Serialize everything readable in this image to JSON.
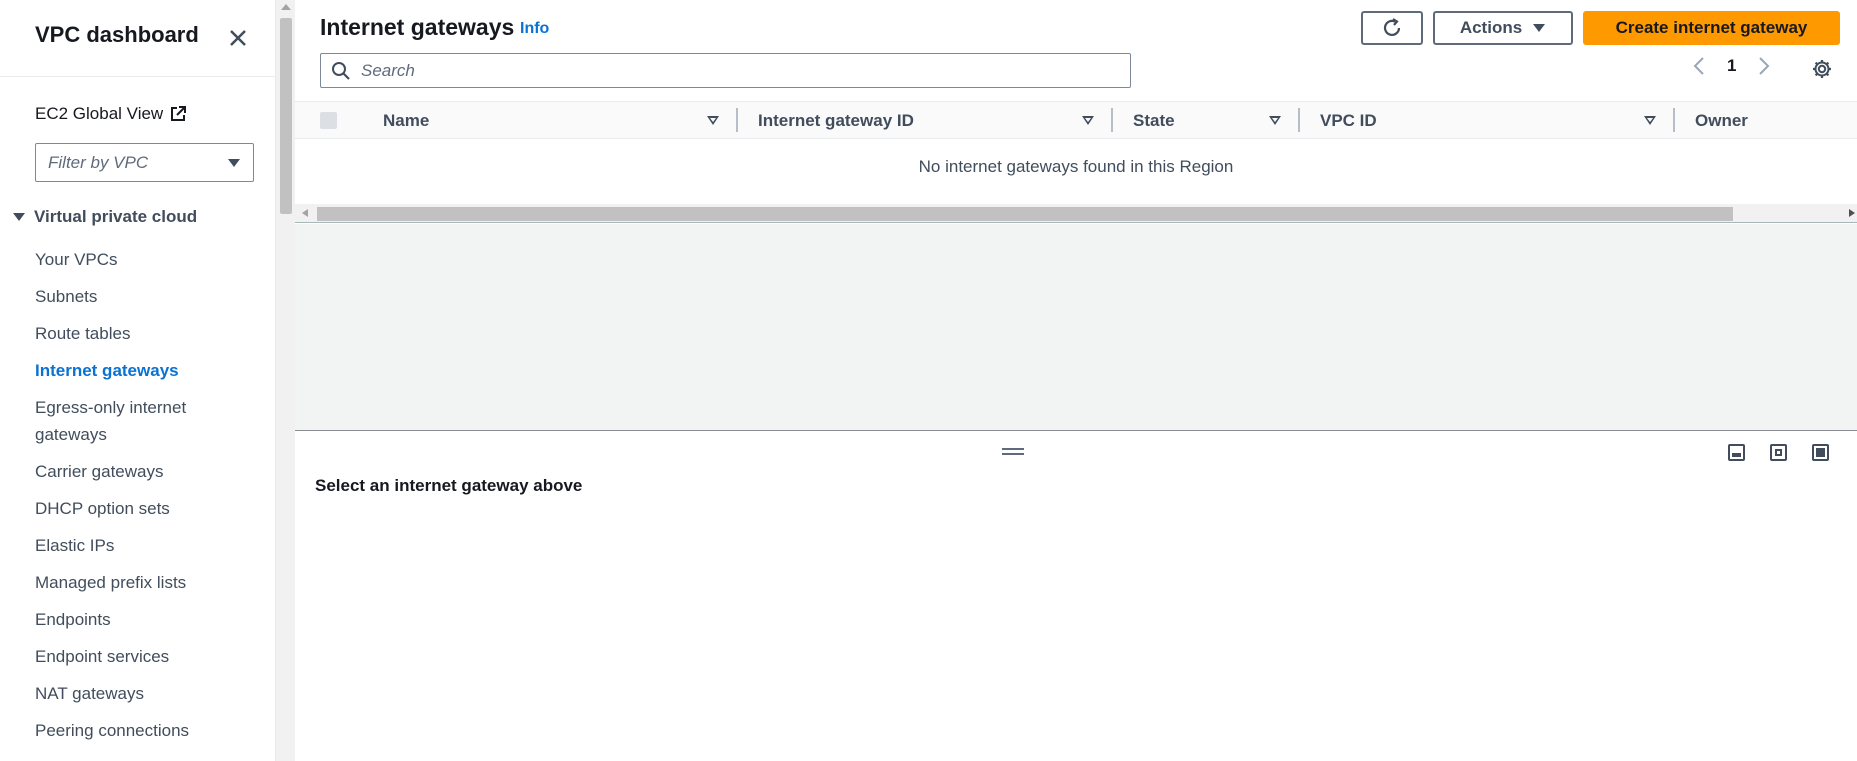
{
  "sidebar": {
    "title": "VPC dashboard",
    "global_view": "EC2 Global View",
    "filter_placeholder": "Filter by VPC",
    "section": "Virtual private cloud",
    "items": [
      {
        "label": "Your VPCs"
      },
      {
        "label": "Subnets"
      },
      {
        "label": "Route tables"
      },
      {
        "label": "Internet gateways",
        "active": true
      },
      {
        "label": "Egress-only internet gateways"
      },
      {
        "label": "Carrier gateways"
      },
      {
        "label": "DHCP option sets"
      },
      {
        "label": "Elastic IPs"
      },
      {
        "label": "Managed prefix lists"
      },
      {
        "label": "Endpoints"
      },
      {
        "label": "Endpoint services"
      },
      {
        "label": "NAT gateways"
      },
      {
        "label": "Peering connections"
      }
    ]
  },
  "header": {
    "title": "Internet gateways",
    "info": "Info",
    "actions_label": "Actions",
    "create_label": "Create internet gateway"
  },
  "search": {
    "placeholder": "Search"
  },
  "pager": {
    "page": "1"
  },
  "table": {
    "columns": [
      "Name",
      "Internet gateway ID",
      "State",
      "VPC ID",
      "Owner"
    ],
    "empty_message": "No internet gateways found in this Region"
  },
  "split_panel": {
    "title": "Select an internet gateway above"
  },
  "colors": {
    "primary": "#ff9900",
    "link": "#0972d3",
    "text": "#16191f"
  }
}
